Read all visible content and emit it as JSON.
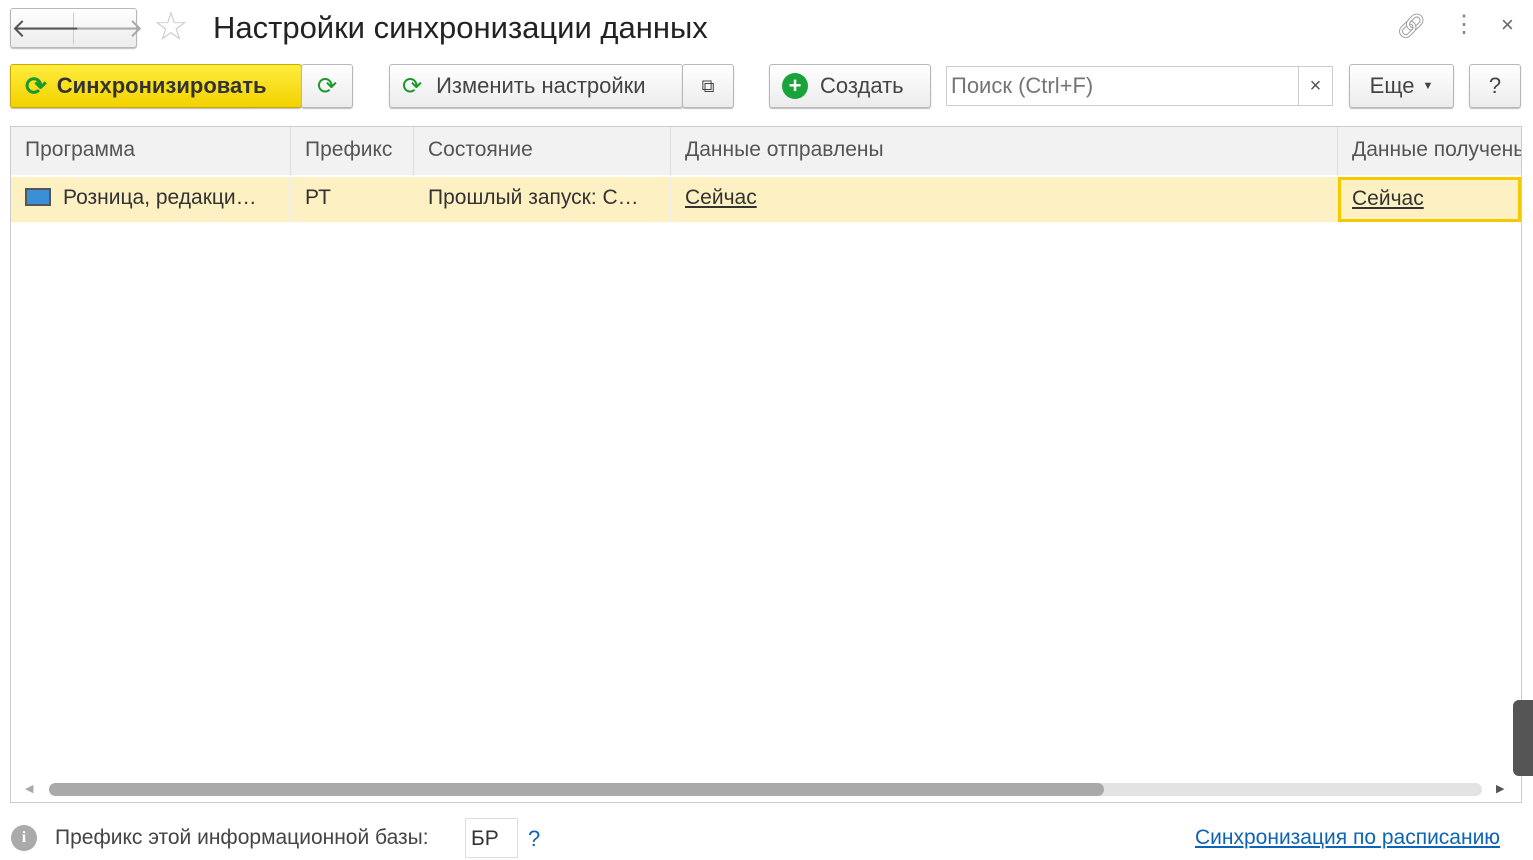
{
  "title": "Настройки синхронизации данных",
  "toolbar": {
    "sync": "Синхронизировать",
    "change_settings": "Изменить настройки",
    "create": "Создать",
    "search_placeholder": "Поиск (Ctrl+F)",
    "clear": "×",
    "more": "Еще",
    "help": "?"
  },
  "table": {
    "columns": [
      "Программа",
      "Префикс",
      "Состояние",
      "Данные отправлены",
      "Данные получены"
    ],
    "rows": [
      {
        "program": "Розница, редакци…",
        "prefix": "РТ",
        "state": "Прошлый запуск: С…",
        "sent": "Сейчас",
        "received": "Сейчас"
      }
    ]
  },
  "footer": {
    "prefix_label": "Префикс этой информационной базы:",
    "prefix_value": "БР",
    "help": "?",
    "schedule_link": "Синхронизация по расписанию"
  },
  "colors": {
    "accent_yellow": "#f5d800",
    "link_blue": "#0e64b4",
    "row_highlight": "#fdf0c2"
  }
}
